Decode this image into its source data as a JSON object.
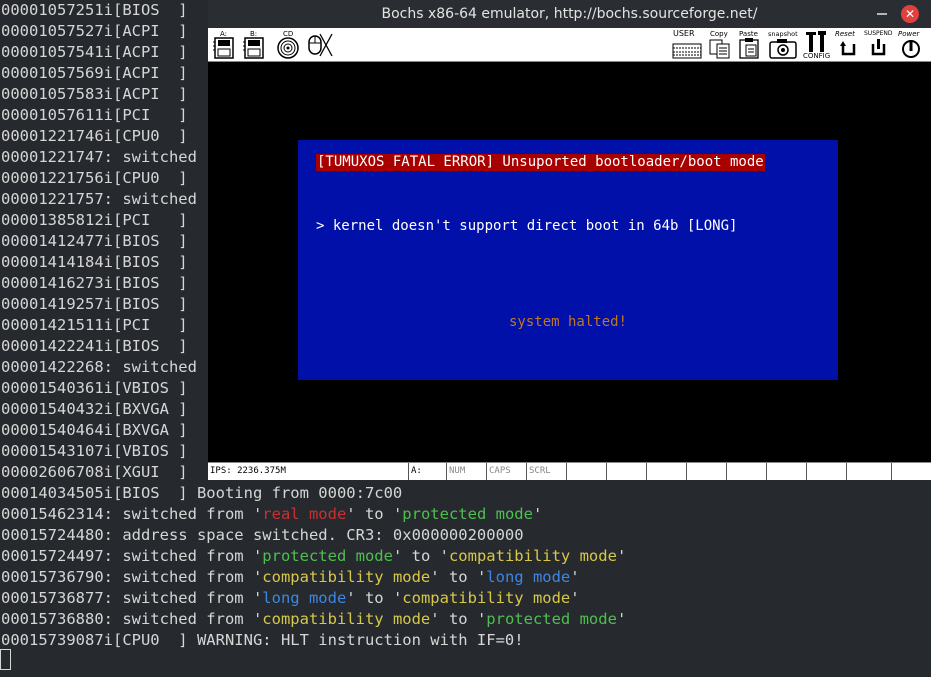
{
  "window": {
    "title": "Bochs x86-64 emulator, http://bochs.sourceforge.net/",
    "minimize_icon": "minimize-icon",
    "close_icon": "close-icon",
    "close_glyph": "✕"
  },
  "toolbar": {
    "floppy_a_label": "A:",
    "floppy_b_label": "B:",
    "cdrom_label": "CD",
    "user_label": "USER",
    "copy_label": "Copy",
    "paste_label": "Paste",
    "snapshot_label": "snapshot",
    "config_label": "CONFIG",
    "reset_label": "Reset",
    "suspend_label": "SUSPEND",
    "power_label": "Power"
  },
  "screen": {
    "error_title": "[TUMUXOS FATAL ERROR] Unsuported bootloader/boot mode",
    "error_message": "> kernel doesn't support direct boot in 64b [LONG]",
    "halt_message": "system halted!"
  },
  "statusbar": {
    "ips": "IPS: 2236.375M",
    "drive": "A:",
    "num": "NUM",
    "caps": "CAPS",
    "scrl": "SCRL"
  },
  "terminal": {
    "lines": [
      "00001057251i[BIOS  ]",
      "00001057527i[ACPI  ]",
      "00001057541i[ACPI  ]",
      "00001057569i[ACPI  ]",
      "00001057583i[ACPI  ]",
      "00001057611i[PCI   ]",
      "00001221746i[CPU0  ]",
      "00001221747: switched",
      "00001221756i[CPU0  ]",
      "00001221757: switched",
      "00001385812i[PCI   ]",
      "00001412477i[BIOS  ]",
      "00001414184i[BIOS  ]",
      "00001416273i[BIOS  ]",
      "00001419257i[BIOS  ]",
      "00001421511i[PCI   ]",
      "00001422241i[BIOS  ]",
      "00001422268: switched",
      "00001540361i[VBIOS ]",
      "00001540432i[BXVGA ]",
      "00001540464i[BXVGA ]",
      "00001543107i[VBIOS ]",
      "00002606708i[XGUI  ]"
    ],
    "bottom_lines": [
      [
        {
          "t": "00014034505i[BIOS  ] Booting from 0000:7c00"
        }
      ],
      [
        {
          "t": "00015462314: switched from '"
        },
        {
          "t": "real mode",
          "c": "red"
        },
        {
          "t": "' to '"
        },
        {
          "t": "protected mode",
          "c": "green"
        },
        {
          "t": "'"
        }
      ],
      [
        {
          "t": "00015724480: address space switched. CR3: 0x000000200000"
        }
      ],
      [
        {
          "t": "00015724497: switched from '"
        },
        {
          "t": "protected mode",
          "c": "green"
        },
        {
          "t": "' to '"
        },
        {
          "t": "compatibility mode",
          "c": "yellow"
        },
        {
          "t": "'"
        }
      ],
      [
        {
          "t": "00015736790: switched from '"
        },
        {
          "t": "compatibility mode",
          "c": "yellow"
        },
        {
          "t": "' to '"
        },
        {
          "t": "long mode",
          "c": "blue"
        },
        {
          "t": "'"
        }
      ],
      [
        {
          "t": "00015736877: switched from '"
        },
        {
          "t": "long mode",
          "c": "blue"
        },
        {
          "t": "' to '"
        },
        {
          "t": "compatibility mode",
          "c": "yellow"
        },
        {
          "t": "'"
        }
      ],
      [
        {
          "t": "00015736880: switched from '"
        },
        {
          "t": "compatibility mode",
          "c": "yellow"
        },
        {
          "t": "' to '"
        },
        {
          "t": "protected mode",
          "c": "green"
        },
        {
          "t": "'"
        }
      ],
      [
        {
          "t": "00015739087i[CPU0  ] WARNING: HLT instruction with IF=0!"
        }
      ]
    ]
  },
  "colors": {
    "terminal_bg": "#262a2e",
    "terminal_fg": "#d6d6d6",
    "dialog_bg": "#0010a8",
    "error_title_bg": "#a80000",
    "halt_text": "#c07820"
  }
}
